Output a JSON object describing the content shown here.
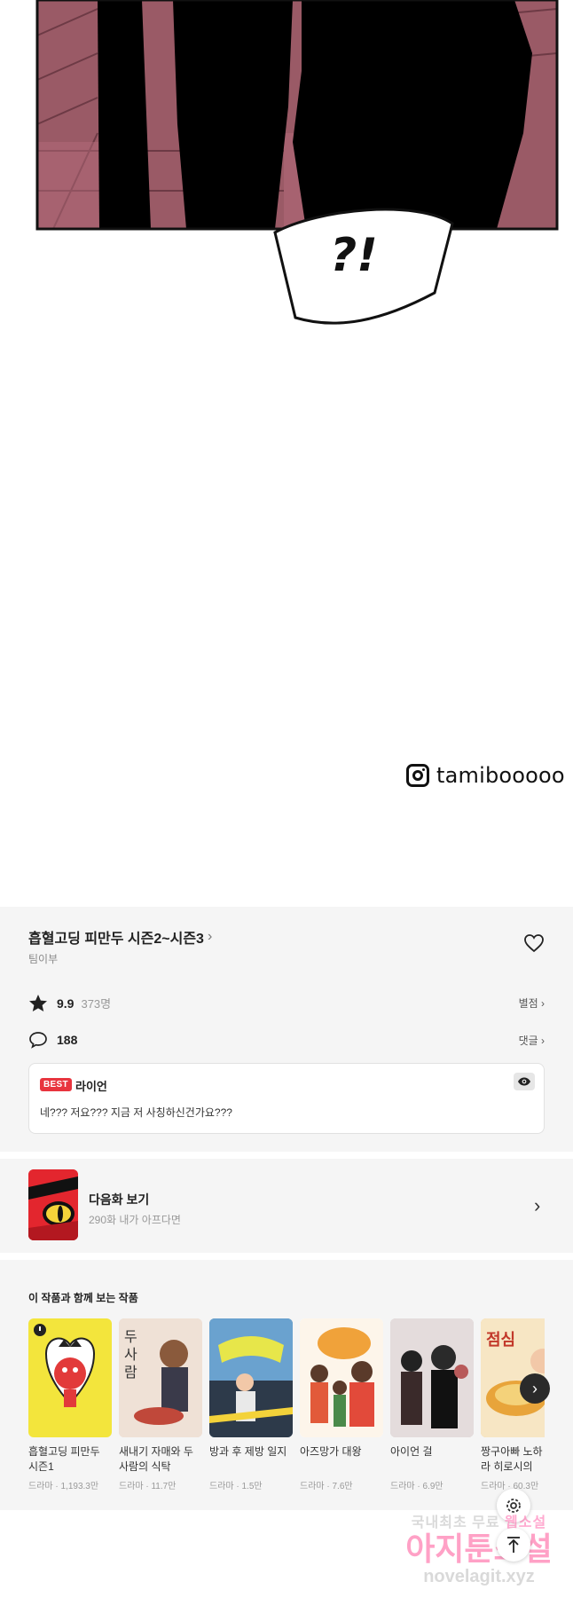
{
  "comic": {
    "speech_text": "?!",
    "instagram_handle": "tamibooooo"
  },
  "info": {
    "series_title": "흡혈고딩 피만두 시즌2~시즌3",
    "author": "팀이부",
    "rating_value": "9.9",
    "rating_count": "373명",
    "rating_link": "별점",
    "comment_count": "188",
    "comment_link": "댓글",
    "best_badge": "BEST",
    "best_user": "라이언",
    "best_text": "네??? 저요??? 지금 저 사칭하신건가요???"
  },
  "next_episode": {
    "label": "다음화 보기",
    "subtitle": "290화 내가 아프다면"
  },
  "recommendations": {
    "title": "이 작품과 함께 보는 작품",
    "items": [
      {
        "name": "흡혈고딩 피만두 시즌1",
        "meta": "드라마 · 1,193.3만",
        "color": "#f3e53c"
      },
      {
        "name": "새내기 자매와 두 사람의 식탁",
        "meta": "드라마 · 11.7만",
        "color": "#e8d4c6"
      },
      {
        "name": "방과 후 제방 일지",
        "meta": "드라마 · 1.5만",
        "color": "#4c7aa6"
      },
      {
        "name": "아즈망가 대왕",
        "meta": "드라마 · 7.6만",
        "color": "#e25a3a"
      },
      {
        "name": "아이언 걸",
        "meta": "드라마 · 6.9만",
        "color": "#cfc6c6"
      },
      {
        "name": "짱구아빠 노하라 히로시의 점심",
        "meta": "드라마 · 60.3만",
        "color": "#f0c77a"
      }
    ]
  },
  "watermark": {
    "line1a": "국내최초 무료",
    "line1b": "웹소설",
    "line2": "아지툰소설",
    "line3": "novelagit.xyz"
  },
  "colors": {
    "best_badge": "#e8343e",
    "section_bg": "#f5f5f5"
  }
}
